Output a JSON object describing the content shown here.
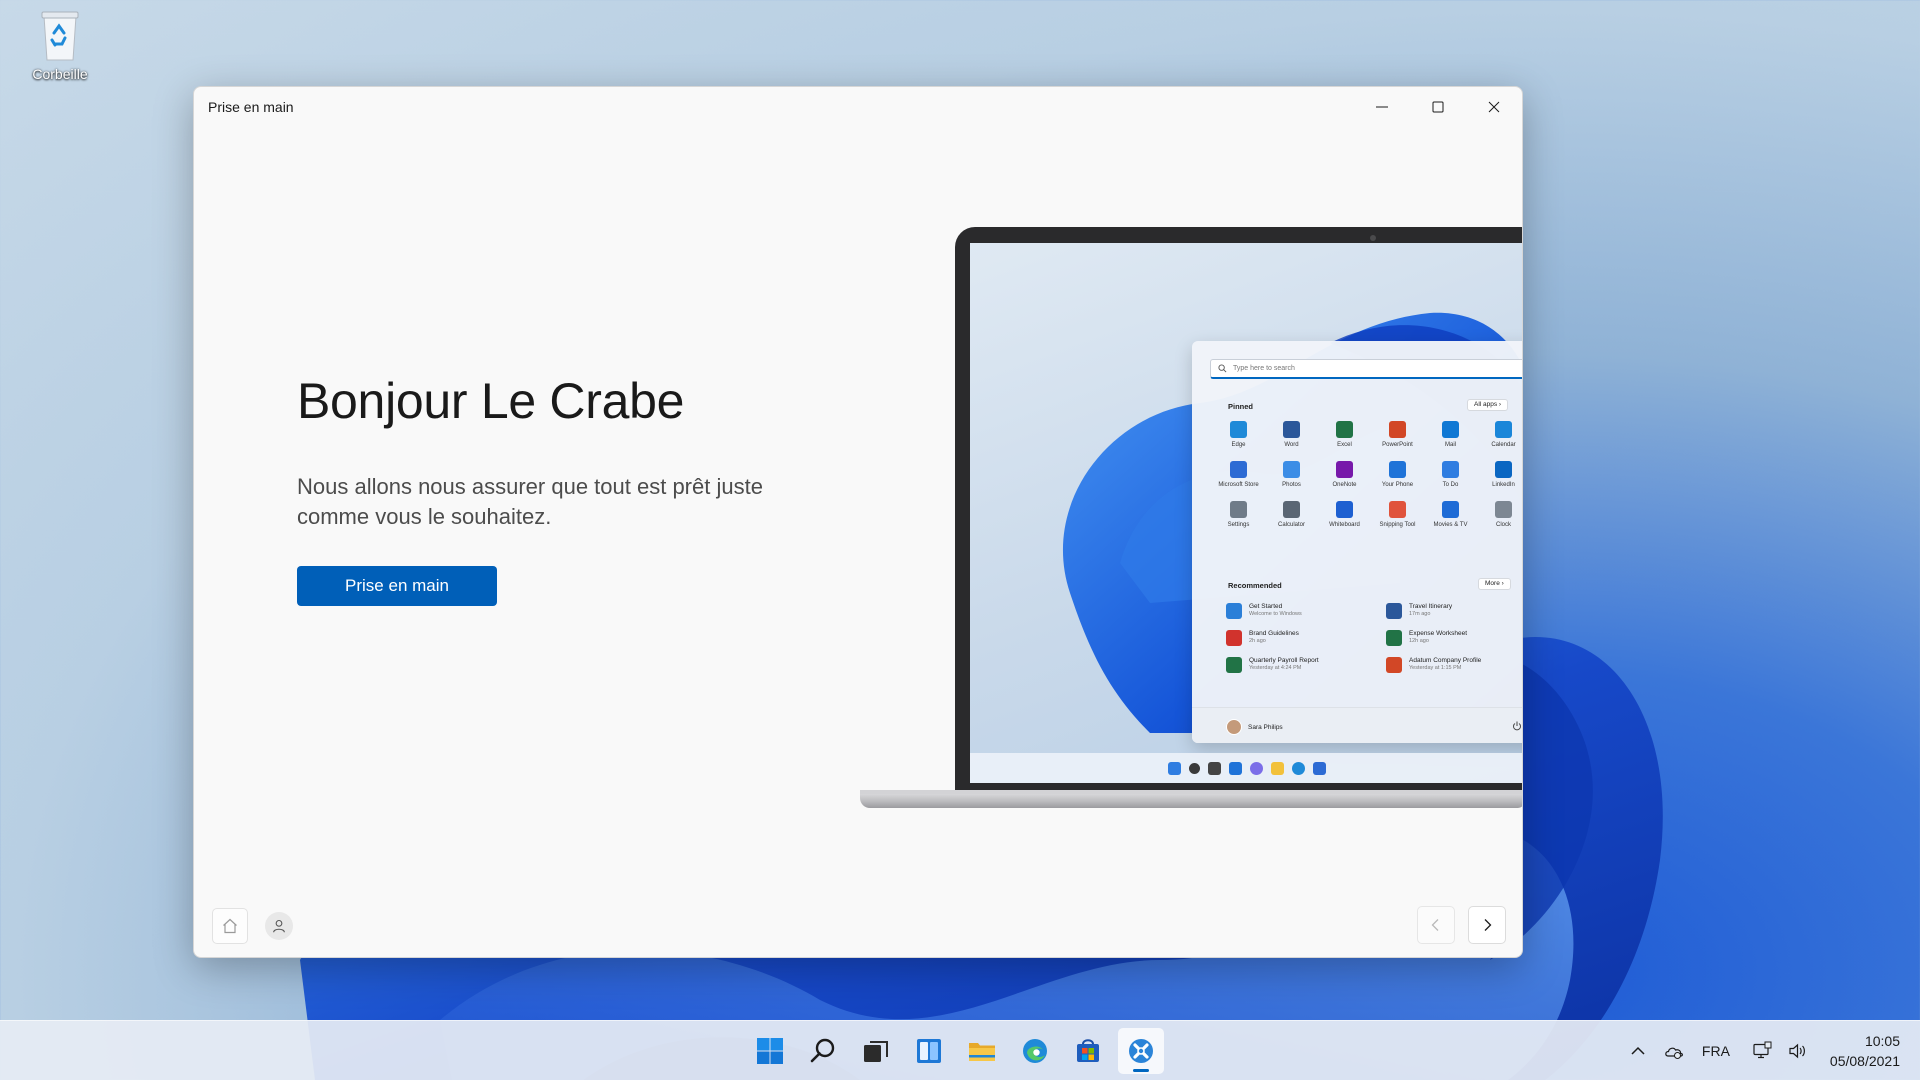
{
  "desktop": {
    "recycle_bin_label": "Corbeille"
  },
  "window": {
    "title": "Prise en main",
    "greeting": "Bonjour Le Crabe",
    "subtitle": "Nous allons nous assurer que tout est prêt juste comme vous le souhaitez.",
    "cta_label": "Prise en main",
    "accent_color": "#005fb8",
    "caption_buttons": [
      "minimize-icon",
      "maximize-icon",
      "close-icon"
    ],
    "footer_icons": [
      "home-icon",
      "user-icon",
      "chevron-left-icon",
      "chevron-right-icon"
    ]
  },
  "illustration": {
    "search_placeholder": "Type here to search",
    "pinned_header": "Pinned",
    "all_apps_label": "All apps",
    "pinned_apps": [
      {
        "name": "Edge",
        "color": "#1f8ad8"
      },
      {
        "name": "Word",
        "color": "#2b579a"
      },
      {
        "name": "Excel",
        "color": "#217346"
      },
      {
        "name": "PowerPoint",
        "color": "#d24726"
      },
      {
        "name": "Mail",
        "color": "#0f78d4"
      },
      {
        "name": "Calendar",
        "color": "#1a86d9"
      },
      {
        "name": "Microsoft Store",
        "color": "#2d6bd4"
      },
      {
        "name": "Photos",
        "color": "#3c8de6"
      },
      {
        "name": "OneNote",
        "color": "#7719aa"
      },
      {
        "name": "Your Phone",
        "color": "#1f73d8"
      },
      {
        "name": "To Do",
        "color": "#2f7de1"
      },
      {
        "name": "LinkedIn",
        "color": "#0a66c2"
      },
      {
        "name": "Settings",
        "color": "#6f7b88"
      },
      {
        "name": "Calculator",
        "color": "#5a6674"
      },
      {
        "name": "Whiteboard",
        "color": "#1d5fd1"
      },
      {
        "name": "Snipping Tool",
        "color": "#e0533c"
      },
      {
        "name": "Movies & TV",
        "color": "#1e6bd6"
      },
      {
        "name": "Clock",
        "color": "#7d8793"
      }
    ],
    "recommended_header": "Recommended",
    "more_label": "More",
    "recommended": [
      {
        "title": "Get Started",
        "sub": "Welcome to Windows",
        "color": "#2b7fd8"
      },
      {
        "title": "Travel Itinerary",
        "sub": "17m ago",
        "color": "#2b579a"
      },
      {
        "title": "Brand Guidelines",
        "sub": "2h ago",
        "color": "#d1332d"
      },
      {
        "title": "Expense Worksheet",
        "sub": "12h ago",
        "color": "#217346"
      },
      {
        "title": "Quarterly Payroll Report",
        "sub": "Yesterday at 4:24 PM",
        "color": "#217346"
      },
      {
        "title": "Adatum Company Profile",
        "sub": "Yesterday at 1:15 PM",
        "color": "#d24726"
      }
    ],
    "user_name": "Sara Philips"
  },
  "taskbar": {
    "apps": [
      {
        "name": "start-button",
        "icon": "windows-logo-icon",
        "active": false
      },
      {
        "name": "search-button",
        "icon": "search-icon",
        "active": false
      },
      {
        "name": "task-view-button",
        "icon": "task-view-icon",
        "active": false
      },
      {
        "name": "widgets-button",
        "icon": "widgets-icon",
        "active": false
      },
      {
        "name": "file-explorer-button",
        "icon": "folder-icon",
        "active": false
      },
      {
        "name": "edge-button",
        "icon": "edge-icon",
        "active": false
      },
      {
        "name": "store-button",
        "icon": "store-icon",
        "active": false
      },
      {
        "name": "get-started-button",
        "icon": "get-started-icon",
        "active": true
      }
    ],
    "tray": {
      "language": "FRA",
      "time": "10:05",
      "date": "05/08/2021",
      "icons": [
        "chevron-up-icon",
        "onedrive-icon",
        "network-icon",
        "volume-icon"
      ]
    }
  }
}
